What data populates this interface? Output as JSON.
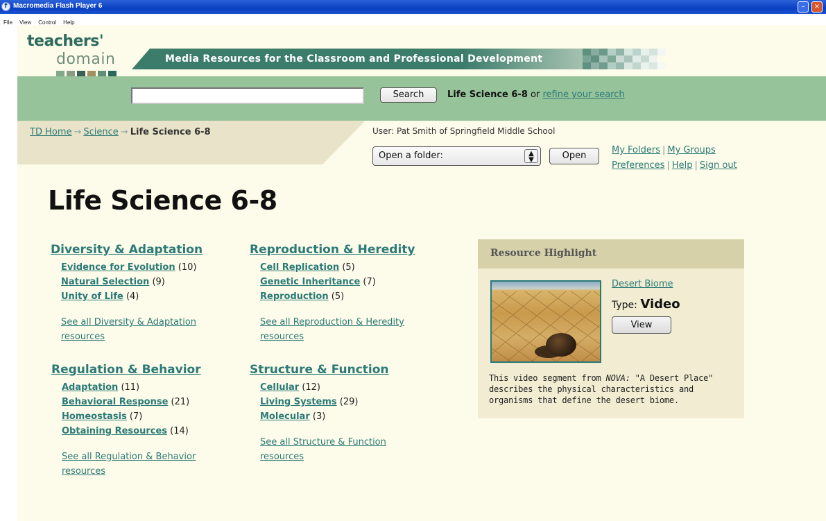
{
  "window": {
    "title": "Macromedia Flash Player 6",
    "menu": [
      "File",
      "View",
      "Control",
      "Help"
    ]
  },
  "colors": {
    "accent": "#2a7a77",
    "search_band": "#96c39a",
    "tagline_bar": "#3c7c6b",
    "page_bg": "#fdfbe9"
  },
  "header": {
    "logo_top": "teachers'",
    "logo_bottom": "domain",
    "tagline": "Media Resources for the Classroom and Professional Development"
  },
  "search": {
    "value": "",
    "button_label": "Search",
    "context_current": "Life Science 6-8",
    "context_or": "or",
    "refine_link": "refine your search"
  },
  "breadcrumb": {
    "items": [
      "TD Home",
      "Science"
    ],
    "current": "Life Science 6-8",
    "separator": "→"
  },
  "user": {
    "line": "User: Pat Smith of Springfield Middle School",
    "folder_select": "Open a folder:",
    "open_button": "Open",
    "links": {
      "my_folders": "My Folders",
      "my_groups": "My Groups",
      "preferences": "Preferences",
      "help": "Help",
      "sign_out": "Sign out"
    },
    "sep": "|"
  },
  "page_title": "Life Science 6-8",
  "categories": [
    {
      "title": "Diversity & Adaptation",
      "items": [
        {
          "label": "Evidence for Evolution",
          "count": "(10)"
        },
        {
          "label": "Natural Selection",
          "count": "(9)"
        },
        {
          "label": "Unity of Life",
          "count": "(4)"
        }
      ],
      "see_all": "See all Diversity & Adaptation resources"
    },
    {
      "title": "Reproduction & Heredity",
      "items": [
        {
          "label": "Cell Replication",
          "count": "(5)"
        },
        {
          "label": "Genetic Inheritance",
          "count": "(7)"
        },
        {
          "label": "Reproduction",
          "count": "(5)"
        }
      ],
      "see_all": "See all Reproduction & Heredity resources"
    },
    {
      "title": "Regulation & Behavior",
      "items": [
        {
          "label": "Adaptation",
          "count": "(11)"
        },
        {
          "label": "Behavioral Response",
          "count": "(21)"
        },
        {
          "label": "Homeostasis",
          "count": "(7)"
        },
        {
          "label": "Obtaining Resources",
          "count": "(14)"
        }
      ],
      "see_all": "See all Regulation & Behavior resources"
    },
    {
      "title": "Structure & Function",
      "items": [
        {
          "label": "Cellular",
          "count": "(12)"
        },
        {
          "label": "Living Systems",
          "count": "(29)"
        },
        {
          "label": "Molecular",
          "count": "(3)"
        }
      ],
      "see_all": "See all Structure & Function resources"
    }
  ],
  "highlight": {
    "heading": "Resource Highlight",
    "resource_title": "Desert Biome",
    "type_label": "Type:",
    "type_value": "Video",
    "view_button": "View",
    "desc_pre": "This video segment from ",
    "desc_source": "NOVA:",
    "desc_post": " \"A Desert Place\" describes the physical characteristics and organisms that define the desert biome."
  }
}
